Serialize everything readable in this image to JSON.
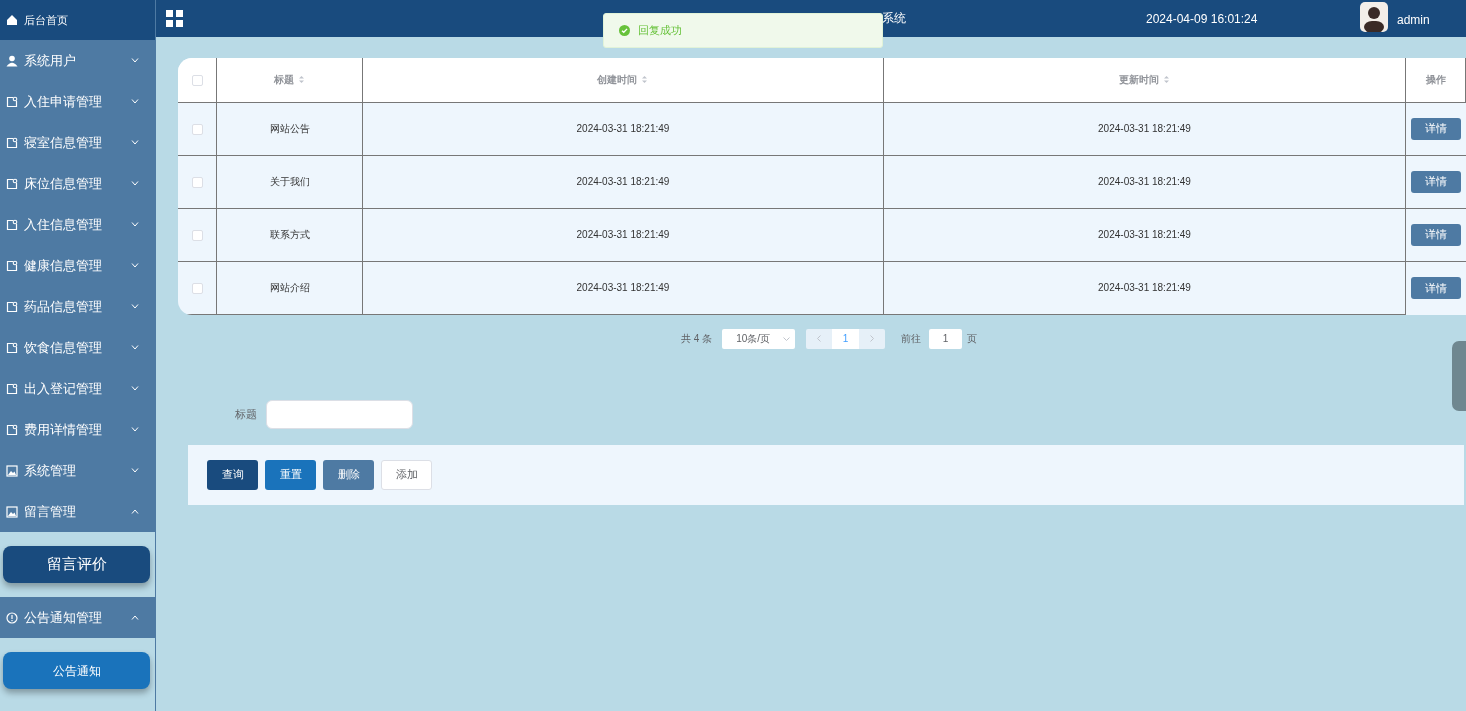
{
  "sidebar": {
    "home": "后台首页",
    "items": [
      {
        "label": "系统用户",
        "expanded": false
      },
      {
        "label": "入住申请管理",
        "expanded": false
      },
      {
        "label": "寝室信息管理",
        "expanded": false
      },
      {
        "label": "床位信息管理",
        "expanded": false
      },
      {
        "label": "入住信息管理",
        "expanded": false
      },
      {
        "label": "健康信息管理",
        "expanded": false
      },
      {
        "label": "药品信息管理",
        "expanded": false
      },
      {
        "label": "饮食信息管理",
        "expanded": false
      },
      {
        "label": "出入登记管理",
        "expanded": false
      },
      {
        "label": "费用详情管理",
        "expanded": false
      },
      {
        "label": "系统管理",
        "expanded": false
      },
      {
        "label": "留言管理",
        "expanded": true,
        "children": [
          {
            "label": "留言评价",
            "selected": false
          }
        ]
      },
      {
        "label": "公告通知管理",
        "expanded": true,
        "children": [
          {
            "label": "公告通知",
            "selected": true
          }
        ]
      }
    ]
  },
  "header": {
    "title_visible": "系统",
    "datetime": "2024-04-09 16:01:24",
    "user": "admin"
  },
  "toast": {
    "message": "回复成功"
  },
  "table": {
    "select_all_checked": false,
    "columns": [
      "标题",
      "创建时间",
      "更新时间",
      "操作"
    ],
    "rows": [
      {
        "checked": false,
        "title": "网站公告",
        "created": "2024-03-31 18:21:49",
        "updated": "2024-03-31 18:21:49",
        "action": "详情"
      },
      {
        "checked": false,
        "title": "关于我们",
        "created": "2024-03-31 18:21:49",
        "updated": "2024-03-31 18:21:49",
        "action": "详情"
      },
      {
        "checked": false,
        "title": "联系方式",
        "created": "2024-03-31 18:21:49",
        "updated": "2024-03-31 18:21:49",
        "action": "详情"
      },
      {
        "checked": false,
        "title": "网站介绍",
        "created": "2024-03-31 18:21:49",
        "updated": "2024-03-31 18:21:49",
        "action": "详情"
      }
    ]
  },
  "pagination": {
    "total": "共 4 条",
    "page_size": "10条/页",
    "pages": [
      {
        "label": "1",
        "selected": true
      }
    ],
    "goto_label": "前往",
    "goto_value": "1",
    "goto_suffix": "页"
  },
  "search": {
    "label": "标题"
  },
  "buttons": [
    {
      "label": "查询",
      "kind": "query"
    },
    {
      "label": "重置",
      "kind": "reset"
    },
    {
      "label": "删除",
      "kind": "delete"
    },
    {
      "label": "添加",
      "kind": "add"
    }
  ]
}
